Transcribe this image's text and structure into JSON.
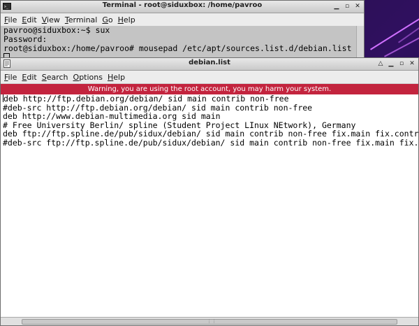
{
  "terminal": {
    "title": "Terminal - root@siduxbox: /home/pavroo",
    "menu": [
      "File",
      "Edit",
      "View",
      "Terminal",
      "Go",
      "Help"
    ],
    "lines": [
      "pavroo@siduxbox:~$ sux",
      "Password:",
      "root@siduxbox:/home/pavroo# mousepad /etc/apt/sources.list.d/debian.list"
    ]
  },
  "editor": {
    "title": "debian.list",
    "menu": [
      "File",
      "Edit",
      "Search",
      "Options",
      "Help"
    ],
    "warning": "Warning, you are using the root account, you may harm your system.",
    "lines": [
      "deb http://ftp.debian.org/debian/ sid main contrib non-free",
      "#deb-src http://ftp.debian.org/debian/ sid main contrib non-free",
      "deb http://www.debian-multimedia.org sid main",
      "# Free University Berlin/ spline (Student Project LInux NEtwork), Germany",
      "deb ftp://ftp.spline.de/pub/sidux/debian/ sid main contrib non-free fix.main fix.contrib fix",
      "#deb-src ftp://ftp.spline.de/pub/sidux/debian/ sid main contrib non-free fix.main fix.contri"
    ]
  },
  "colors": {
    "warning_bg": "#c3243e",
    "terminal_bg": "#c4c4c4"
  }
}
